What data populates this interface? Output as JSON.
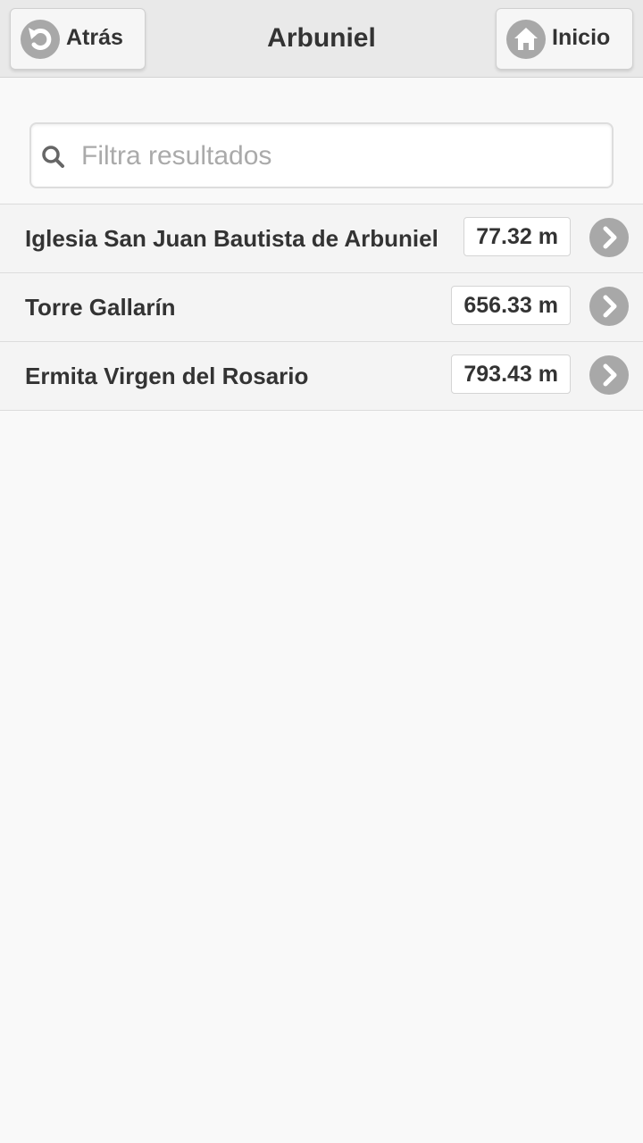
{
  "header": {
    "title": "Arbuniel",
    "back_label": "Atrás",
    "home_label": "Inicio",
    "back_icon": "back-arrow-icon",
    "home_icon": "home-icon"
  },
  "search": {
    "placeholder": "Filtra resultados",
    "value": "",
    "icon": "search-icon"
  },
  "results": [
    {
      "name": "Iglesia San Juan Bautista de Arbuniel",
      "distance": "77.32 m"
    },
    {
      "name": "Torre Gallarín",
      "distance": "656.33 m"
    },
    {
      "name": "Ermita Virgen del Rosario",
      "distance": "793.43 m"
    }
  ],
  "colors": {
    "header_bg": "#e9e9e9",
    "page_bg": "#f9f9f9",
    "icon_circle": "#a8a8a8",
    "text": "#333333"
  }
}
